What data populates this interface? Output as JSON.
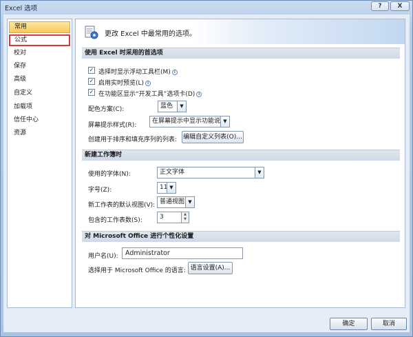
{
  "window": {
    "title": "Excel 选项",
    "help_label": "?",
    "close_label": "X"
  },
  "sidebar": {
    "items": [
      {
        "label": "常用",
        "state": "selected"
      },
      {
        "label": "公式",
        "state": "focused"
      },
      {
        "label": "校对"
      },
      {
        "label": "保存"
      },
      {
        "label": "高级"
      },
      {
        "label": "自定义"
      },
      {
        "label": "加载项"
      },
      {
        "label": "信任中心"
      },
      {
        "label": "资源"
      }
    ]
  },
  "header": {
    "text": "更改 Excel 中最常用的选项。",
    "icon": "options-settings-icon"
  },
  "sections": {
    "top": {
      "title": "使用 Excel 时采用的首选项"
    },
    "new_workbook": {
      "title": "新建工作簿时"
    },
    "personalize": {
      "title": "对 Microsoft Office 进行个性化设置"
    }
  },
  "preferences": {
    "show_mini_toolbar": {
      "label": "选择时显示浮动工具栏(M)",
      "checked": true
    },
    "live_preview": {
      "label": "启用实时预览(L)",
      "checked": true
    },
    "developer_tab": {
      "label": "在功能区显示“开发工具”选项卡(D)",
      "checked": true
    },
    "color_scheme": {
      "label": "配色方案(C):",
      "value": "蓝色"
    },
    "screentip_style": {
      "label": "屏幕提示样式(R):",
      "value": "在屏幕提示中显示功能说明"
    },
    "custom_lists": {
      "label": "创建用于排序和填充序列的列表:",
      "button": "编辑自定义列表(O)..."
    }
  },
  "new_workbook": {
    "font": {
      "label": "使用的字体(N):",
      "value": "正文字体"
    },
    "font_size": {
      "label": "字号(Z):",
      "value": "11"
    },
    "default_view": {
      "label": "新工作表的默认视图(V):",
      "value": "普通视图"
    },
    "sheet_count": {
      "label": "包含的工作表数(S):",
      "value": "3"
    }
  },
  "personalize": {
    "username": {
      "label": "用户名(U):",
      "value": "Administrator"
    },
    "language": {
      "label": "选择用于 Microsoft Office 的语言:",
      "button": "语言设置(A)..."
    }
  },
  "footer": {
    "ok_label": "确定",
    "cancel_label": "取消"
  },
  "colors": {
    "selected_item": "#f9c95b",
    "focus_outline": "#d83a3a",
    "section_band": "#d6dfea"
  }
}
